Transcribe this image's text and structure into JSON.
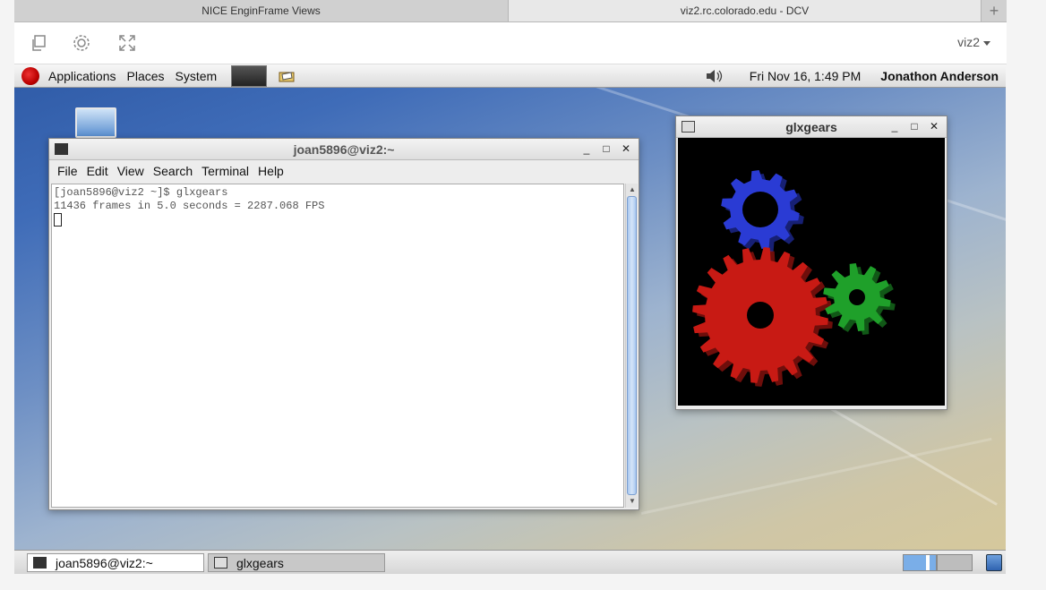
{
  "browser": {
    "tabs": [
      {
        "label": "NICE EnginFrame Views"
      },
      {
        "label": "viz2.rc.colorado.edu - DCV"
      }
    ],
    "new_tab": "+"
  },
  "dcv_toolbar": {
    "session_label": "viz2",
    "icons": [
      "copy-icon",
      "gear-icon",
      "fullscreen-icon"
    ]
  },
  "top_panel": {
    "menus": [
      "Applications",
      "Places",
      "System"
    ],
    "clock": "Fri Nov 16,  1:49 PM",
    "user": "Jonathon Anderson"
  },
  "terminal": {
    "title": "joan5896@viz2:~",
    "menus": [
      "File",
      "Edit",
      "View",
      "Search",
      "Terminal",
      "Help"
    ],
    "lines": [
      "[joan5896@viz2 ~]$ glxgears",
      "11436 frames in 5.0 seconds = 2287.068 FPS"
    ]
  },
  "glxgears": {
    "title": "glxgears",
    "gear_colors": {
      "large": "#c81a14",
      "small": "#1fa02a",
      "top": "#2a3bd4"
    }
  },
  "window_buttons": {
    "minimize": "_",
    "maximize": "□",
    "close": "✕"
  },
  "taskbar": {
    "tasks": [
      {
        "label": "joan5896@viz2:~"
      },
      {
        "label": "glxgears"
      }
    ]
  }
}
